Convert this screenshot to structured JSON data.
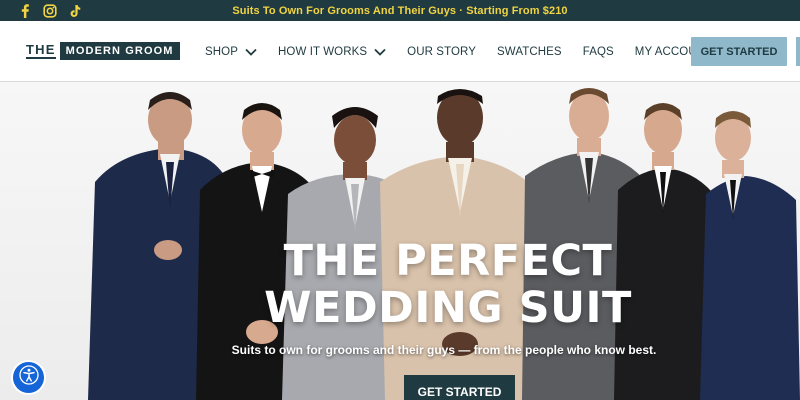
{
  "announcement": {
    "text": "Suits To Own For Grooms And Their Guys · Starting From $210",
    "social_icons": [
      "facebook-icon",
      "instagram-icon",
      "tiktok-icon"
    ]
  },
  "header": {
    "logo_the": "THE",
    "logo_name": "MODERN GROOM",
    "nav": [
      {
        "label": "SHOP",
        "has_dropdown": true
      },
      {
        "label": "HOW IT WORKS",
        "has_dropdown": true
      },
      {
        "label": "OUR STORY",
        "has_dropdown": false
      },
      {
        "label": "SWATCHES",
        "has_dropdown": false
      },
      {
        "label": "FAQS",
        "has_dropdown": false
      },
      {
        "label": "MY ACCOUNT",
        "has_dropdown": true
      }
    ],
    "cta_label": "GET STARTED"
  },
  "hero": {
    "title_line1": "THE PERFECT",
    "title_line2": "WEDDING SUIT",
    "subtitle": "Suits to own for grooms and their guys — from the people who know best.",
    "cta_label": "GET STARTED"
  },
  "accessibility": {
    "icon": "accessibility-icon"
  },
  "colors": {
    "brand_dark": "#1f3a40",
    "announcement_text": "#f1d443",
    "header_cta_bg": "#8fb8ca",
    "accessibility_blue": "#1565d8"
  }
}
